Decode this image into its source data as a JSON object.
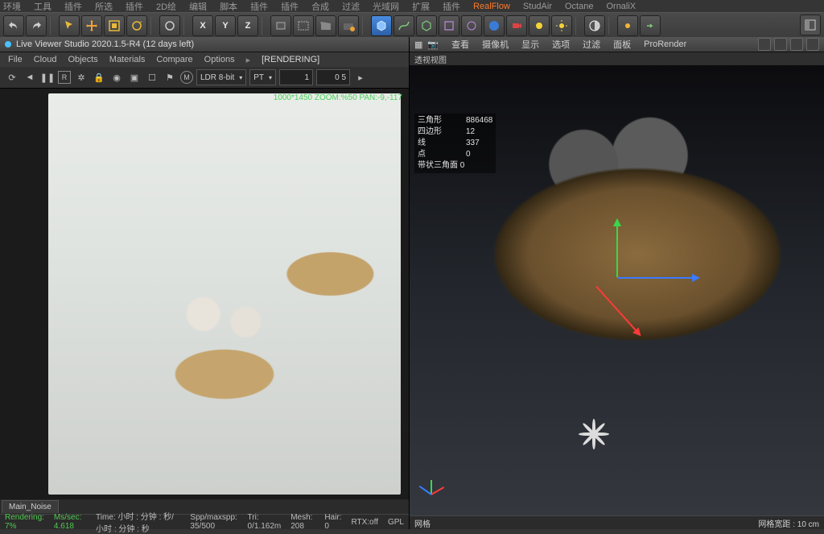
{
  "top_menu": {
    "items": [
      "环境",
      "工具",
      "插件",
      "所选",
      "插件",
      "2D绘",
      "编辑",
      "脚本",
      "插件",
      "插件",
      "合成",
      "过滤",
      "光域网",
      "扩展",
      "插件"
    ],
    "highlighted": "RealFlow",
    "after": [
      "StudAir",
      "Octane",
      "OrnaliX"
    ]
  },
  "toolbar": {
    "axis_labels": {
      "x": "X",
      "y": "Y",
      "z": "Z"
    }
  },
  "live_viewer": {
    "title": "Live Viewer Studio 2020.1.5-R4 (12 days left)",
    "menu": [
      "File",
      "Cloud",
      "Objects",
      "Materials",
      "Compare",
      "Options"
    ],
    "rendering": "[RENDERING]",
    "bitdepth": "LDR 8-bit",
    "mode": "PT",
    "num1": "1",
    "num2": "0  5",
    "overlay": "1000*1450 ZOOM:%50  PAN:-9,-117",
    "tab": "Main_Noise",
    "status": {
      "rendering": "Rendering: 7%",
      "mssec": "Ms/sec: 4.618",
      "time": "Time: 小时 : 分钟 : 秒/小时 : 分钟 : 秒",
      "spp": "Spp/maxspp: 35/500",
      "tri": "Tri: 0/1.162m",
      "mesh": "Mesh: 208",
      "hair": "Hair: 0",
      "rtx": "RTX:off",
      "gpl": "GPL"
    }
  },
  "viewport": {
    "menu": [
      "查看",
      "摄像机",
      "显示",
      "选项",
      "过滤",
      "面板",
      "ProRender"
    ],
    "title": "透视视图",
    "stats": {
      "triangles_k": "三角形",
      "triangles_v": "886468",
      "quads_k": "四边形",
      "quads_v": "12",
      "lines_k": "线",
      "lines_v": "337",
      "points_k": "点",
      "points_v": "0",
      "strip": "带状三角面 0"
    },
    "footer_left": "网格",
    "footer_right": "网格宽距 : 10 cm"
  }
}
